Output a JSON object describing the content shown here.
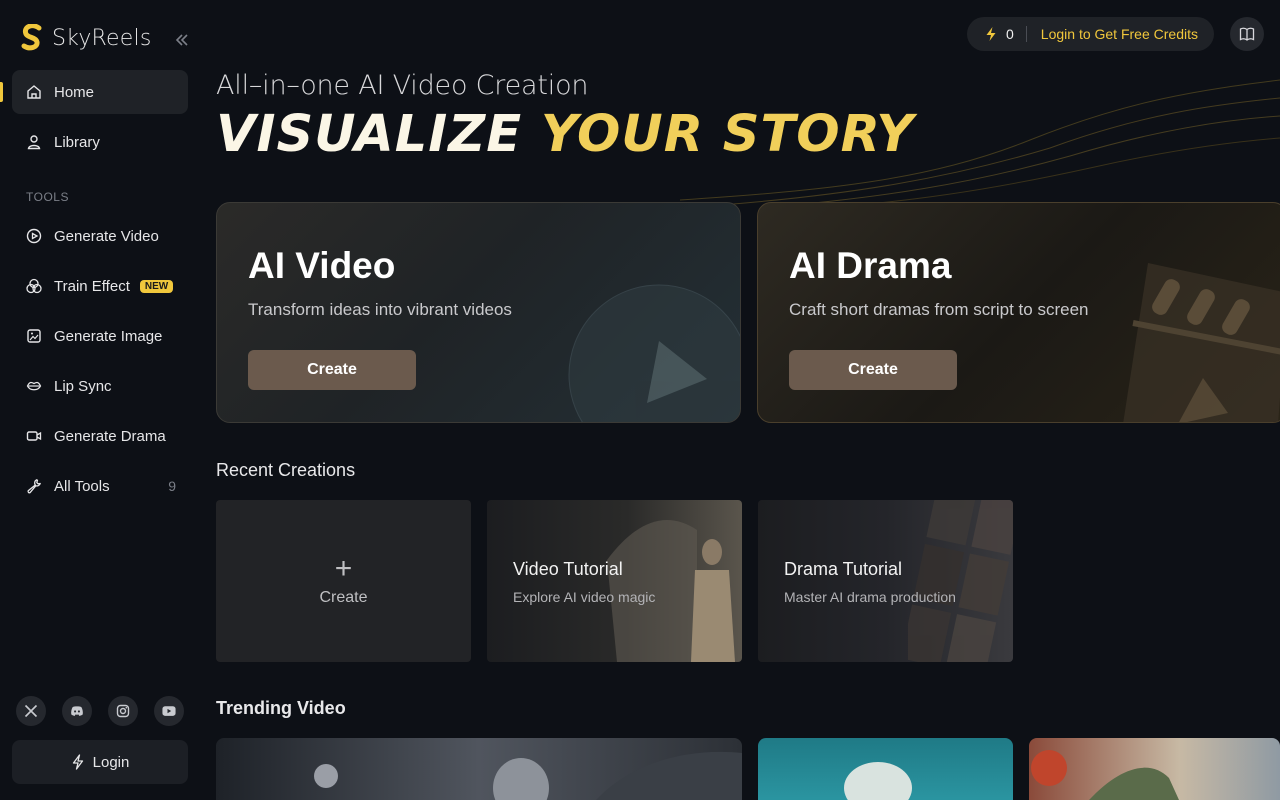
{
  "app": {
    "name": "SkyReels"
  },
  "sidebar": {
    "nav": [
      {
        "label": "Home",
        "icon": "home-icon",
        "active": true
      },
      {
        "label": "Library",
        "icon": "user-icon"
      }
    ],
    "tools_label": "TOOLS",
    "tools": [
      {
        "label": "Generate Video",
        "icon": "play-circle-icon"
      },
      {
        "label": "Train Effect",
        "icon": "effect-icon",
        "badge": "NEW"
      },
      {
        "label": "Generate Image",
        "icon": "image-icon"
      },
      {
        "label": "Lip Sync",
        "icon": "lips-icon"
      },
      {
        "label": "Generate Drama",
        "icon": "camera-icon"
      },
      {
        "label": "All Tools",
        "icon": "wrench-icon",
        "count": "9"
      }
    ],
    "socials": [
      "x-icon",
      "discord-icon",
      "instagram-icon",
      "youtube-icon"
    ],
    "login_label": "Login"
  },
  "topbar": {
    "credits": "0",
    "credits_cta": "Login to Get Free Credits"
  },
  "hero": {
    "subtitle": "All–in–one AI Video Creation",
    "title_part1": "VISUALIZE",
    "title_part2": "YOUR STORY"
  },
  "feature_cards": [
    {
      "title": "AI Video",
      "description": "Transform ideas into vibrant videos",
      "button": "Create"
    },
    {
      "title": "AI Drama",
      "description": "Craft short dramas from script to screen",
      "button": "Create"
    }
  ],
  "recent": {
    "title": "Recent Creations",
    "create_label": "Create",
    "tiles": [
      {
        "title": "Video Tutorial",
        "subtitle": "Explore AI video magic"
      },
      {
        "title": "Drama Tutorial",
        "subtitle": "Master AI drama production"
      }
    ]
  },
  "trending": {
    "title": "Trending Video"
  },
  "colors": {
    "accent": "#f0c73c",
    "background": "#0d1016",
    "button_brown": "#6b5a4d"
  }
}
